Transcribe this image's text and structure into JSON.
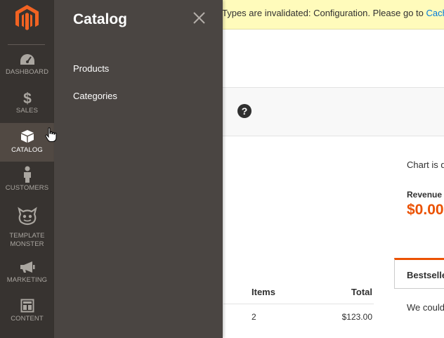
{
  "notice": {
    "text": "Types are invalidated: Configuration. Please go to ",
    "link": "Cach"
  },
  "dashboard": {
    "help_icon": "?",
    "chart_note": "Chart is d",
    "revenue_label": "Revenue",
    "revenue_value": "$0.00",
    "tab_bestsellers": "Bestselle",
    "tab_content": "We couldn",
    "table": {
      "headers": [
        "Items",
        "Total"
      ],
      "rows": [
        {
          "items": "2",
          "total": "$123.00"
        }
      ]
    }
  },
  "nav": {
    "logo": "magento-logo",
    "items": [
      {
        "label": "Dashboard",
        "icon": "speedometer-icon"
      },
      {
        "label": "Sales",
        "icon": "dollar-icon"
      },
      {
        "label": "Catalog",
        "icon": "box-icon",
        "active": true
      },
      {
        "label": "Customers",
        "icon": "person-icon"
      },
      {
        "label": "Template",
        "label2": "Monster",
        "icon": "monster-icon"
      },
      {
        "label": "Marketing",
        "icon": "megaphone-icon"
      },
      {
        "label": "Content",
        "icon": "layout-icon"
      }
    ]
  },
  "flyout": {
    "title": "Catalog",
    "links": [
      "Products",
      "Categories"
    ]
  },
  "colors": {
    "nav_bg": "#373330",
    "nav_active": "#514943",
    "flyout_bg": "#4a4542",
    "accent": "#eb5202",
    "notice_bg": "#fffbbb",
    "link": "#007bdb"
  }
}
